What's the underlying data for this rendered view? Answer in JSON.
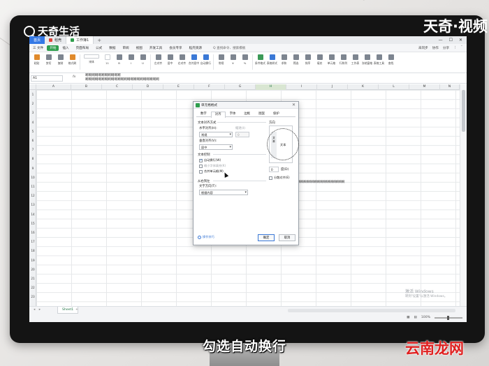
{
  "watermarks": {
    "top_left": "天奇生活",
    "top_right": "天奇·视频",
    "bottom_right": "云南龙网"
  },
  "subtitle": "勾选自动换行",
  "app": {
    "tabs": [
      {
        "label": "首页",
        "active": false
      },
      {
        "label": "稻壳",
        "active": false
      },
      {
        "label": "工作簿1",
        "active": true
      }
    ],
    "tab_plus": "+",
    "window_controls": [
      "—",
      "☐",
      "✕"
    ],
    "menu": [
      "三 文件",
      "开始",
      "插入",
      "页面布局",
      "公式",
      "数据",
      "审阅",
      "视图",
      "开发工具",
      "会员专享",
      "稻壳资源",
      "Q 查找命令、搜索模板"
    ],
    "menu_right": [
      "未同步",
      "协作",
      "分享",
      "⋮",
      "ˆ"
    ],
    "ribbon": [
      "粘贴",
      "剪切",
      "复制",
      "格式刷",
      "宋体",
      "11",
      "B",
      "I",
      "U",
      "左对齐",
      "居中",
      "右对齐",
      "合并居中",
      "自动换行",
      "常规",
      "¥",
      "%",
      "条件格式",
      "表格样式",
      "求和",
      "筛选",
      "排序",
      "填充",
      "单元格",
      "行和列",
      "工作表",
      "冻结窗格",
      "表格工具",
      "查找"
    ]
  },
  "formula_bar": {
    "name_box": "A1",
    "fx": "fx",
    "value_line1": "啊啊啊啊啊啊啊啊啊啊啊",
    "value_line2": "啊啊啊啊啊啊啊啊啊啊啊啊啊啊啊啊啊啊啊啊啊啊啊"
  },
  "grid": {
    "columns": [
      "A",
      "B",
      "C",
      "D",
      "E",
      "F",
      "G",
      "H",
      "I",
      "J",
      "K",
      "L",
      "M",
      "N"
    ],
    "selected_column": "H",
    "rows": [
      "1",
      "2",
      "3",
      "4",
      "5",
      "6",
      "7",
      "8",
      "9",
      "10",
      "11",
      "12",
      "13",
      "14",
      "15",
      "16",
      "17",
      "18",
      "19",
      "20",
      "21",
      "22",
      "23"
    ],
    "cell_overflow_text": "啊啊啊啊啊啊啊啊啊啊啊啊啊啊啊啊啊"
  },
  "sheet_tabs": {
    "nav": "◂ ▸",
    "active": "Sheet1",
    "add": "+"
  },
  "activation_notice": {
    "line1": "激活 Windows",
    "line2": "转到\"设置\"以激活 Windows。"
  },
  "status_bar": {
    "zoom": "100%"
  },
  "dialog": {
    "title": "单元格格式",
    "close": "✕",
    "tabs": [
      "数字",
      "对齐",
      "字体",
      "边框",
      "图案",
      "保护"
    ],
    "active_tab": "对齐",
    "text_alignment_section": "文本对齐方式",
    "horizontal_label": "水平对齐(H):",
    "horizontal_value": "常规",
    "indent_label": "缩进(I):",
    "indent_value": "0",
    "vertical_label": "垂直对齐(V):",
    "vertical_value": "居中",
    "text_control_section": "文本控制",
    "wrap_text": {
      "label": "自动换行(W)",
      "checked": true
    },
    "shrink_to_fit": {
      "label": "缩小字体填充(K)",
      "checked": false
    },
    "merge_cells": {
      "label": "合并单元格(M)",
      "checked": false
    },
    "rtl_section": "从右到左",
    "text_direction_label": "文字方向(T):",
    "text_direction_value": "根据内容",
    "orientation_label": "方向",
    "orientation_vertical_text": "文本",
    "orientation_sample": "文本",
    "degrees_value": "0",
    "degrees_label": "度(D)",
    "distributed_label": "分散对齐(E)",
    "tip_link": "操作技巧",
    "ok_button": "确定",
    "cancel_button": "取消"
  }
}
